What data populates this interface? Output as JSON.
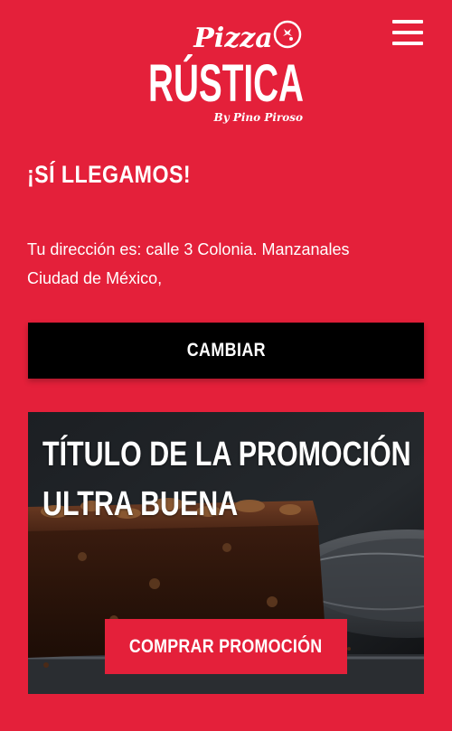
{
  "header": {
    "logo_top": "Pizza",
    "logo_main": "RÚSTICA",
    "logo_byline": "By Pino Piroso",
    "menu_icon": "hamburger-menu-icon",
    "logo_icon": "tomato-icon"
  },
  "delivery": {
    "headline": "¡SÍ LLEGAMOS!",
    "address_line_1": "Tu dirección es: calle 3 Colonia. Manzanales",
    "address_line_2": "Ciudad de México,",
    "change_label": "CAMBIAR"
  },
  "promo": {
    "title_line_1": "TÍTULO DE LA PROMOCIÓN",
    "title_line_2": "ULTRA BUENA",
    "buy_label": "COMPRAR PROMOCIÓN",
    "image": "brownie-photo"
  },
  "colors": {
    "brand_red": "#e4203a",
    "button_black": "#000000",
    "text_white": "#ffffff"
  }
}
